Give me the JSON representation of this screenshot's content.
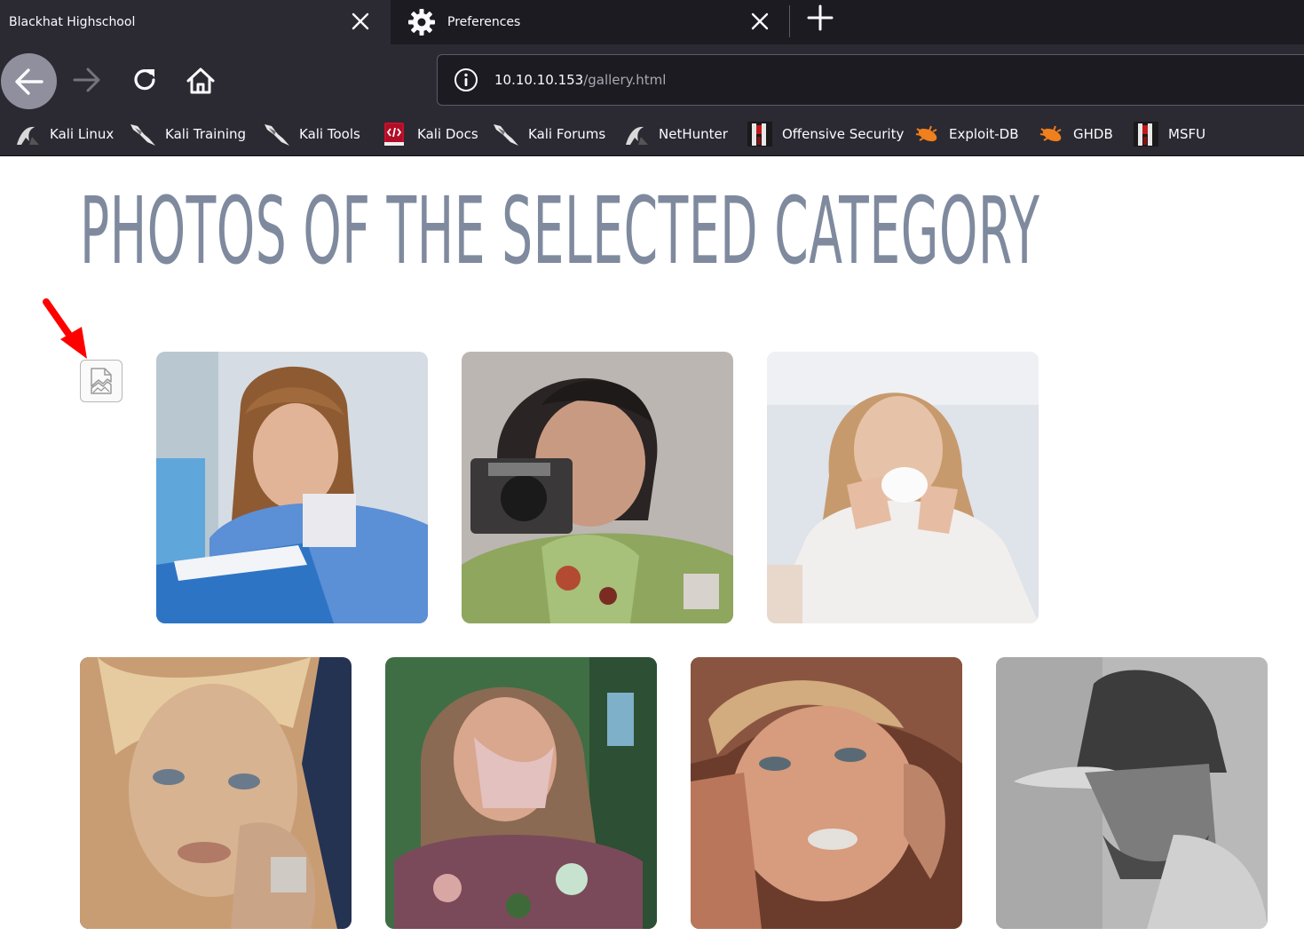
{
  "browser": {
    "tabs": [
      {
        "title": "Blackhat Highschool",
        "active": true
      },
      {
        "title": "Preferences",
        "icon": "gear-icon",
        "active": false
      }
    ],
    "url": {
      "host": "10.10.10.153",
      "path": "/gallery.html"
    },
    "bookmarks": [
      {
        "label": "Kali Linux",
        "icon": "kali-dragon-icon"
      },
      {
        "label": "Kali Training",
        "icon": "kali-dragon-icon"
      },
      {
        "label": "Kali Tools",
        "icon": "kali-dragon-icon"
      },
      {
        "label": "Kali Docs",
        "icon": "kali-docs-icon"
      },
      {
        "label": "Kali Forums",
        "icon": "kali-dragon-icon"
      },
      {
        "label": "NetHunter",
        "icon": "kali-dragon-icon"
      },
      {
        "label": "Offensive Security",
        "icon": "offsec-icon"
      },
      {
        "label": "Exploit-DB",
        "icon": "exploit-db-icon"
      },
      {
        "label": "GHDB",
        "icon": "exploit-db-icon"
      },
      {
        "label": "MSFU",
        "icon": "offsec-icon"
      }
    ]
  },
  "page": {
    "title": "PHOTOS OF THE SELECTED CATEGORY",
    "broken_image": {
      "icon": "broken-image-icon"
    },
    "annotation_arrow": {
      "icon": "red-arrow-icon",
      "color": "#ff0000"
    },
    "photos": [
      {
        "subject": "girl reading a book",
        "colors": [
          "#c8a486",
          "#5b8fd6",
          "#d5dce4"
        ]
      },
      {
        "subject": "woman with camera",
        "colors": [
          "#2e2b2b",
          "#8fa65e",
          "#bcb6b2"
        ]
      },
      {
        "subject": "woman drinking from cup",
        "colors": [
          "#c79a6d",
          "#f1eeee",
          "#d9dde3"
        ]
      },
      {
        "subject": "blonde woman close-up",
        "colors": [
          "#d7b391",
          "#253352",
          "#b07a66"
        ]
      },
      {
        "subject": "woman outdoors",
        "colors": [
          "#8a6a52",
          "#3f6e45",
          "#d9a7a3"
        ]
      },
      {
        "subject": "blonde woman looking up",
        "colors": [
          "#d79b7d",
          "#6b3c2c",
          "#bc8469"
        ]
      },
      {
        "subject": "man in cap, grayscale",
        "colors": [
          "#3c3c3c",
          "#b9b9b9",
          "#d8d8d8"
        ]
      }
    ]
  }
}
